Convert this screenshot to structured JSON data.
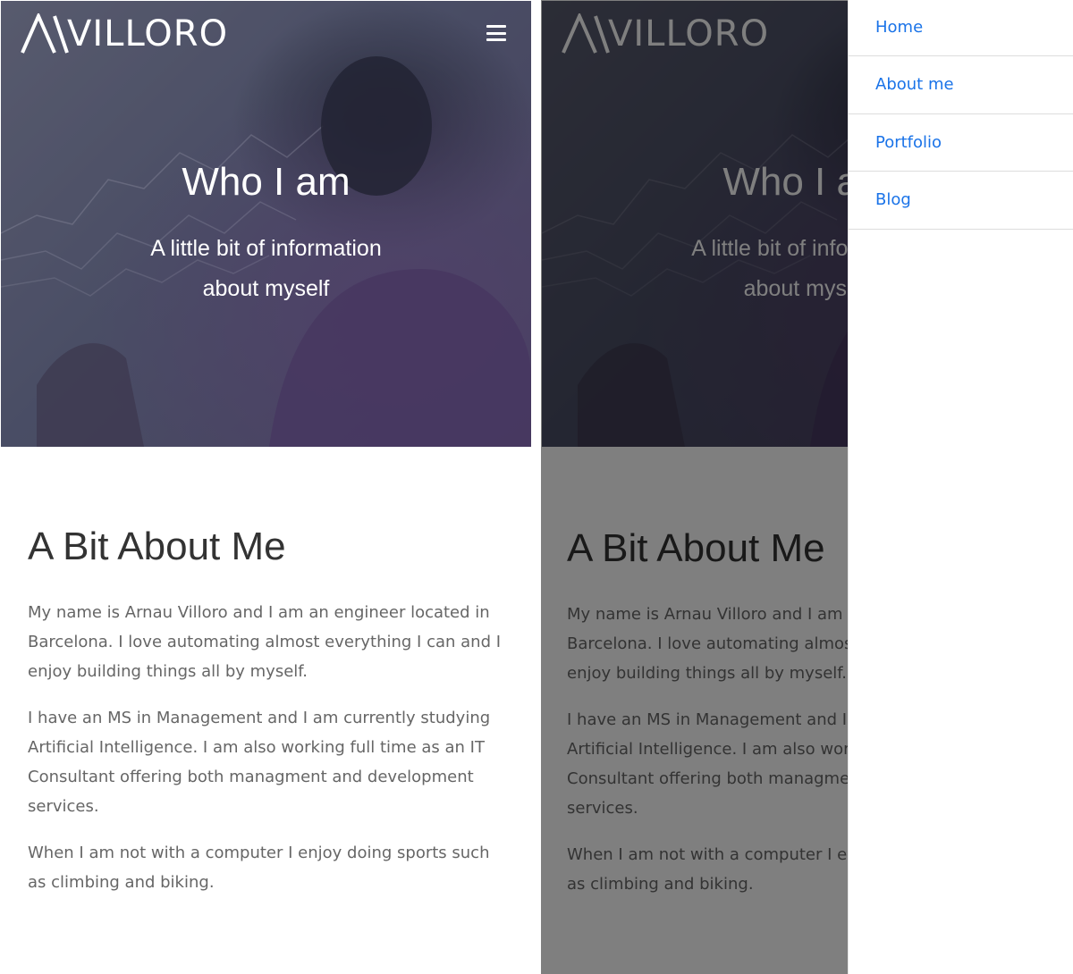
{
  "brand": {
    "logo_text": "VILLORO",
    "logo_letter": "A"
  },
  "hero": {
    "title": "Who I am",
    "subtitle_line1": "A little bit of information",
    "subtitle_line2": "about myself"
  },
  "about": {
    "title": "A Bit About Me",
    "paragraphs": [
      "My name is Arnau Villoro and I am an engineer located in Barcelona. I love automating almost everything I can and I enjoy building things all by myself.",
      "I have an MS in Management and I am currently studying Artificial Intelligence. I am also working full time as an IT Consultant offering both managment and development services.",
      "When I am not with a computer I enjoy doing sports such as climbing and biking."
    ]
  },
  "nav": {
    "menu_icon": "hamburger-menu-icon",
    "items": [
      {
        "label": "Home"
      },
      {
        "label": "About me"
      },
      {
        "label": "Portfolio"
      },
      {
        "label": "Blog"
      }
    ]
  },
  "colors": {
    "link": "#1a73e8",
    "heading": "#333333",
    "body_text": "#666666",
    "overlay": "#000000"
  }
}
